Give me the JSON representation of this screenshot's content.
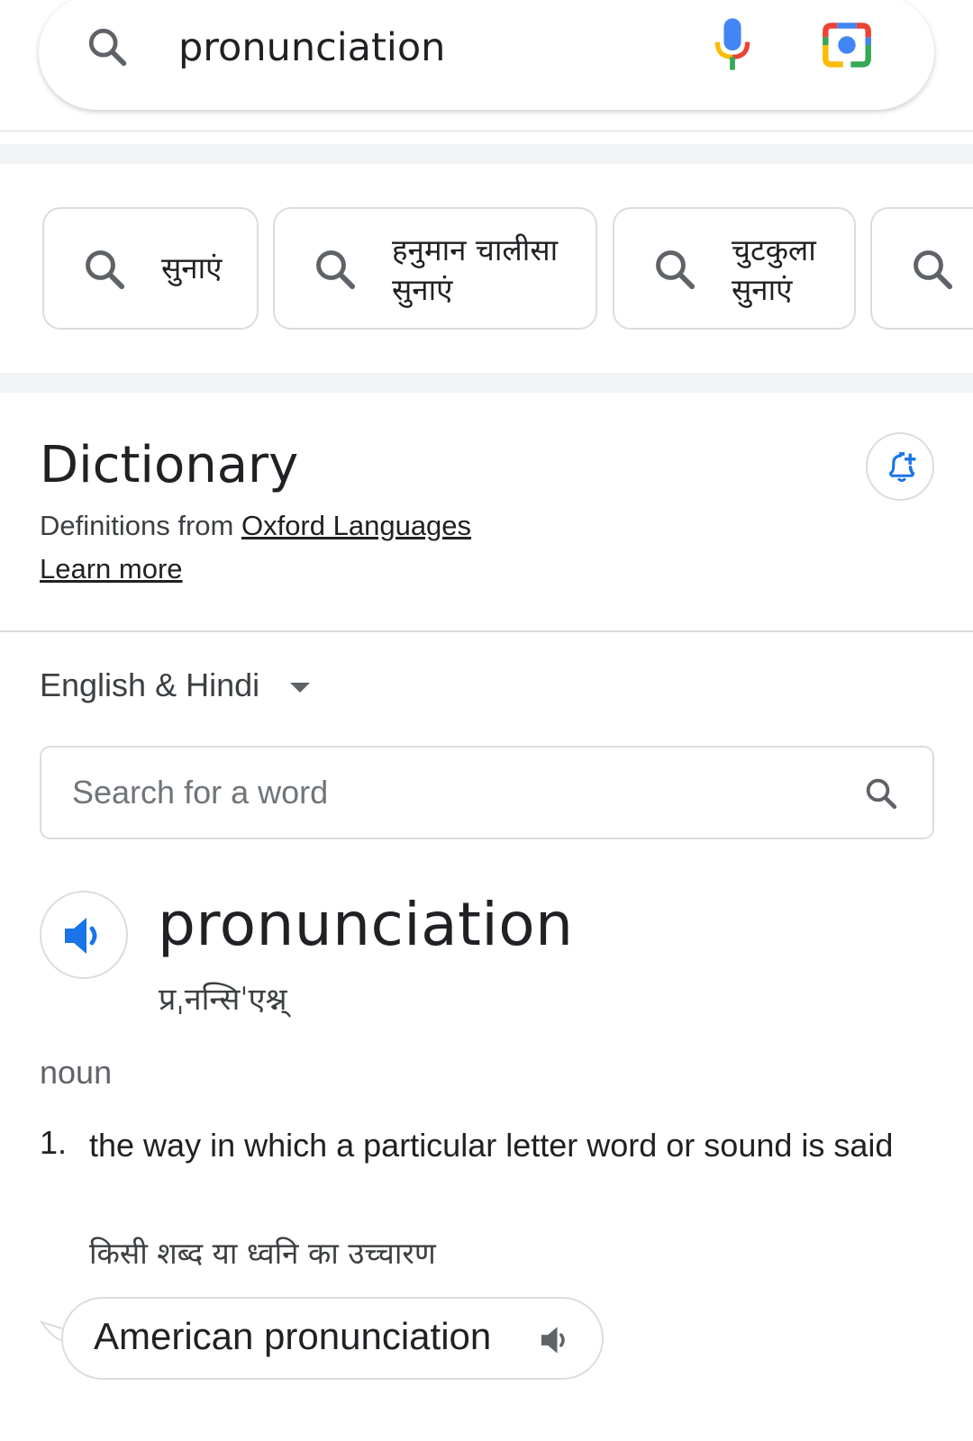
{
  "search": {
    "query": "pronunciation"
  },
  "chips": [
    {
      "label_line1": "सुनाएं",
      "label_line2": ""
    },
    {
      "label_line1": "हनुमान चालीसा",
      "label_line2": "सुनाएं"
    },
    {
      "label_line1": "चुटकुला",
      "label_line2": "सुनाएं"
    }
  ],
  "dictionary": {
    "title": "Dictionary",
    "source_prefix": "Definitions from ",
    "source_link": "Oxford Languages",
    "learn_more": "Learn more",
    "language": "English & Hindi",
    "search_placeholder": "Search for a word",
    "headword": "pronunciation",
    "phonetic": "प्रˌनन्सिˈएश्न्",
    "part_of_speech": "noun",
    "definitions": [
      {
        "number": "1.",
        "text": "the way in which a particular letter word or sound is said",
        "hindi": "किसी शब्द या ध्वनि का उच्चारण"
      }
    ],
    "american_pronunciation": "American pronunciation"
  },
  "colors": {
    "google_blue": "#4285f4",
    "google_red": "#ea4335",
    "google_yellow": "#fbbc04",
    "google_green": "#34a853",
    "border": "#dadce0",
    "speaker_blue": "#1a73e8"
  },
  "icons": [
    "search-icon",
    "mic-icon",
    "lens-camera-icon",
    "bell-add-icon",
    "dropdown-caret-icon",
    "speaker-icon"
  ]
}
